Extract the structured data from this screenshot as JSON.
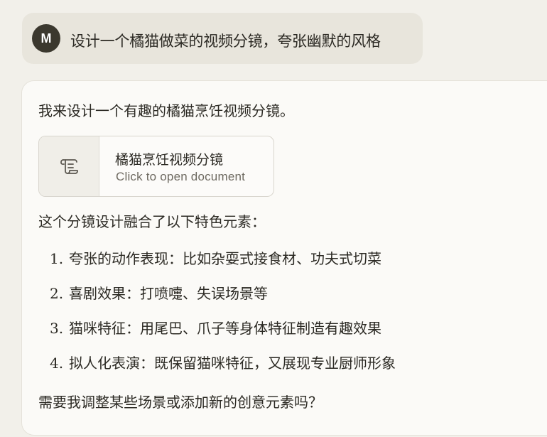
{
  "user": {
    "avatar_initial": "M",
    "message": "设计一个橘猫做菜的视频分镜，夸张幽默的风格"
  },
  "assistant": {
    "intro": "我来设计一个有趣的橘猫烹饪视频分镜。",
    "artifact": {
      "icon": "scroll-document-icon",
      "title": "橘猫烹饪视频分镜",
      "subtitle": "Click to open document"
    },
    "summary": "这个分镜设计融合了以下特色元素：",
    "list": [
      {
        "num": "1.",
        "text": "夸张的动作表现：比如杂耍式接食材、功夫式切菜"
      },
      {
        "num": "2.",
        "text": "喜剧效果：打喷嚏、失误场景等"
      },
      {
        "num": "3.",
        "text": "猫咪特征：用尾巴、爪子等身体特征制造有趣效果"
      },
      {
        "num": "4.",
        "text": "拟人化表演：既保留猫咪特征，又展现专业厨师形象"
      }
    ],
    "closing": "需要我调整某些场景或添加新的创意元素吗？"
  }
}
